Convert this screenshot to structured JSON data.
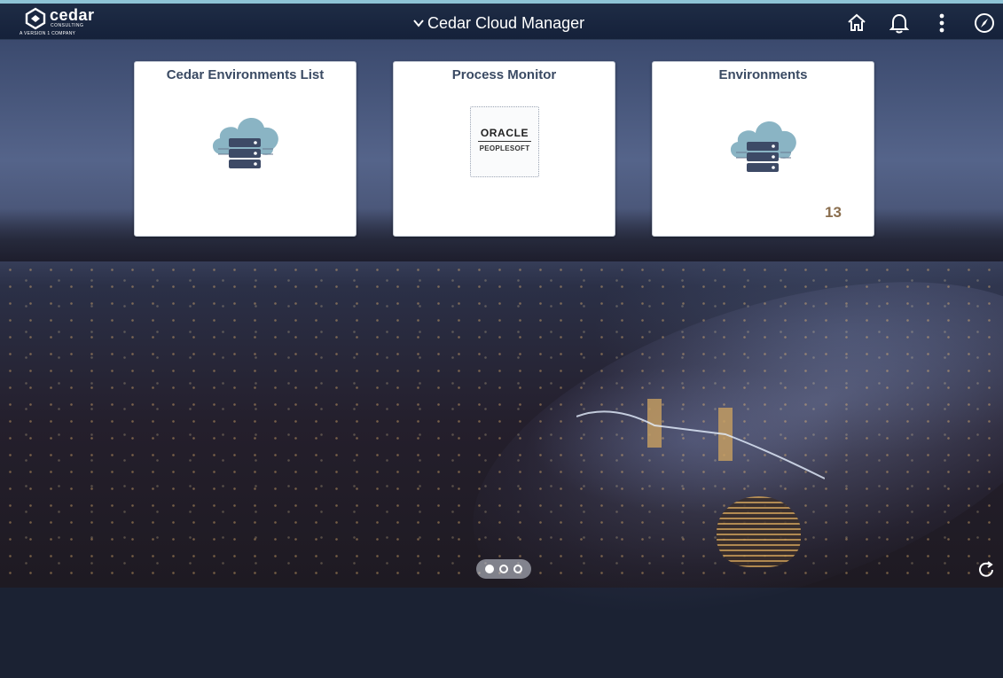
{
  "app": {
    "logo_word": "cedar",
    "logo_sub": "CONSULTING",
    "logo_tag": "A VERSION 1 COMPANY",
    "title": "Cedar Cloud Manager"
  },
  "header_icons": [
    "home-icon",
    "bell-icon",
    "more-vertical-icon",
    "compass-icon"
  ],
  "tiles": [
    {
      "title": "Cedar Environments List",
      "icon": "cloud-server-icon"
    },
    {
      "title": "Process Monitor",
      "icon": "oracle-peoplesoft-logo",
      "logo_word": "ORACLE",
      "logo_sub": "PEOPLESOFT"
    },
    {
      "title": "Environments",
      "icon": "cloud-server-icon",
      "count": "13"
    }
  ],
  "pager": {
    "pages": 3,
    "active": 1
  },
  "colors": {
    "tile_title": "#3a4a63",
    "count": "#8a6e4e",
    "header": "#1e2c45",
    "accent_strip": "#8ec3d6"
  }
}
